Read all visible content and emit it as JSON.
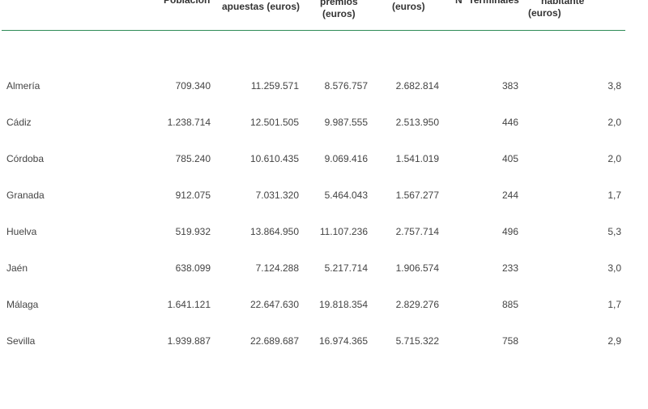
{
  "table": {
    "headers": {
      "poblacion": "Población",
      "apuestas": "apuestas (euros)",
      "premios_1": "premios",
      "premios_2": "(euros)",
      "recaudacion": "(euros)",
      "terminales": "Nº Terminales",
      "habitante_1": "habitante",
      "habitante_2": "(euros)"
    },
    "rows": [
      {
        "provincia": "Almería",
        "poblacion": "709.340",
        "apuestas": "11.259.571",
        "premios": "8.576.757",
        "recaudacion": "2.682.814",
        "terminales": "383",
        "por_habitante": "3,8"
      },
      {
        "provincia": "Cádiz",
        "poblacion": "1.238.714",
        "apuestas": "12.501.505",
        "premios": "9.987.555",
        "recaudacion": "2.513.950",
        "terminales": "446",
        "por_habitante": "2,0"
      },
      {
        "provincia": "Córdoba",
        "poblacion": "785.240",
        "apuestas": "10.610.435",
        "premios": "9.069.416",
        "recaudacion": "1.541.019",
        "terminales": "405",
        "por_habitante": "2,0"
      },
      {
        "provincia": "Granada",
        "poblacion": "912.075",
        "apuestas": "7.031.320",
        "premios": "5.464.043",
        "recaudacion": "1.567.277",
        "terminales": "244",
        "por_habitante": "1,7"
      },
      {
        "provincia": "Huelva",
        "poblacion": "519.932",
        "apuestas": "13.864.950",
        "premios": "11.107.236",
        "recaudacion": "2.757.714",
        "terminales": "496",
        "por_habitante": "5,3"
      },
      {
        "provincia": "Jaén",
        "poblacion": "638.099",
        "apuestas": "7.124.288",
        "premios": "5.217.714",
        "recaudacion": "1.906.574",
        "terminales": "233",
        "por_habitante": "3,0"
      },
      {
        "provincia": "Málaga",
        "poblacion": "1.641.121",
        "apuestas": "22.647.630",
        "premios": "19.818.354",
        "recaudacion": "2.829.276",
        "terminales": "885",
        "por_habitante": "1,7"
      },
      {
        "provincia": "Sevilla",
        "poblacion": "1.939.887",
        "apuestas": "22.689.687",
        "premios": "16.974.365",
        "recaudacion": "5.715.322",
        "terminales": "758",
        "por_habitante": "2,9"
      }
    ]
  }
}
